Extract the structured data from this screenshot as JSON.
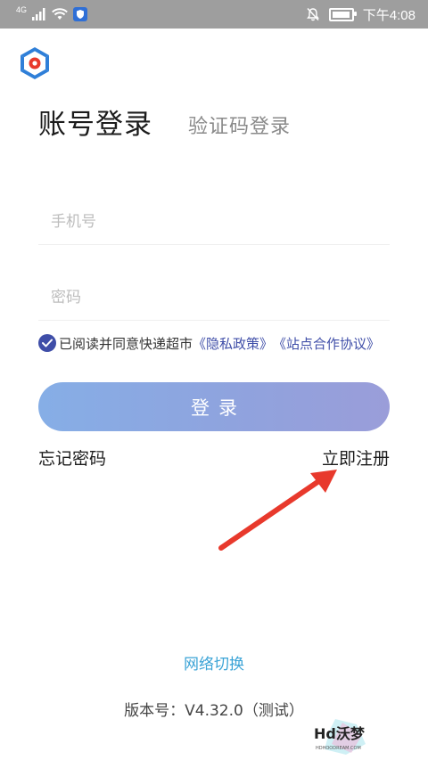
{
  "status_bar": {
    "network": "4G",
    "time": "下午4:08"
  },
  "login": {
    "tab_active": "账号登录",
    "tab_inactive": "验证码登录",
    "phone_placeholder": "手机号",
    "password_placeholder": "密码",
    "agreement": {
      "prefix": "已阅读并同意快递超市",
      "privacy_link": "《隐私政策》",
      "station_link": "《站点合作协议》",
      "checked": true
    },
    "login_button": "登录",
    "forgot_password": "忘记密码",
    "register": "立即注册"
  },
  "footer": {
    "network_switch": "网络切换",
    "version": "版本号：V4.32.0（测试）"
  },
  "watermark": {
    "brand": "Hd沃梦",
    "url": "HDHOODREAM.COM"
  },
  "colors": {
    "status_bar": "#9e9e9e",
    "accent": "#3f4ea8",
    "network_link": "#3aa3d6",
    "button_gradient_start": "#86aee6",
    "button_gradient_end": "#9a9dd9",
    "annotation_arrow": "#e8392c"
  }
}
